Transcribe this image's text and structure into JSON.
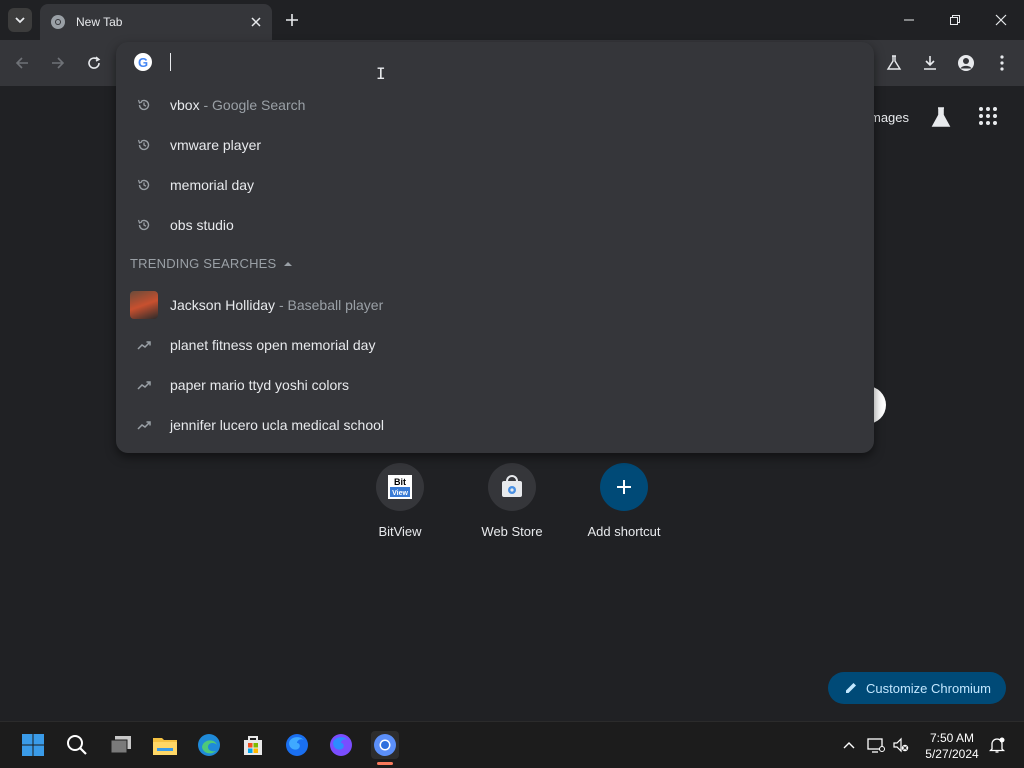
{
  "window": {
    "tab_title": "New Tab"
  },
  "omnibox": {
    "input_value": "",
    "history": [
      {
        "text": "vbox",
        "sub": " - Google Search",
        "icon": "history-icon"
      },
      {
        "text": "vmware player",
        "sub": "",
        "icon": "history-icon"
      },
      {
        "text": "memorial day",
        "sub": "",
        "icon": "history-icon"
      },
      {
        "text": "obs studio",
        "sub": "",
        "icon": "history-icon"
      }
    ],
    "trending_header": "TRENDING SEARCHES",
    "trending": [
      {
        "text": "Jackson Holliday",
        "sub": " - Baseball player",
        "icon": "person-thumbnail"
      },
      {
        "text": "planet fitness open memorial day",
        "sub": "",
        "icon": "trending-icon"
      },
      {
        "text": "paper mario ttyd yoshi colors",
        "sub": "",
        "icon": "trending-icon"
      },
      {
        "text": "jennifer lucero ucla medical school",
        "sub": "",
        "icon": "trending-icon"
      }
    ]
  },
  "page": {
    "images_link": "mages",
    "shortcuts": [
      {
        "label": "BitView",
        "icon": "bitview-icon"
      },
      {
        "label": "Web Store",
        "icon": "webstore-icon"
      },
      {
        "label": "Add shortcut",
        "icon": "plus-icon"
      }
    ],
    "customize_label": "Customize Chromium"
  },
  "taskbar": {
    "time": "7:50 AM",
    "date": "5/27/2024",
    "apps": [
      "windows-start-icon",
      "search-icon",
      "task-view-icon",
      "file-explorer-icon",
      "edge-icon",
      "store-icon",
      "firefox-icon",
      "firefox-dev-icon",
      "chromium-icon"
    ]
  },
  "colors": {
    "accent_blue": "#004a77",
    "customize_text": "#c2e7ff",
    "taskbar_bg": "#1c1c1c",
    "dropdown_bg": "#35363a"
  }
}
